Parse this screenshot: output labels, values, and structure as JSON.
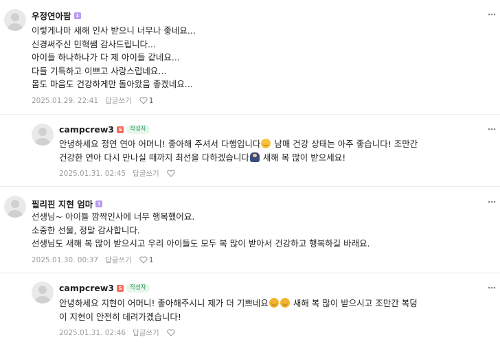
{
  "comments": [
    {
      "author": "우정연아팜",
      "level_badge": "1",
      "text": "이렇게나마 새해 인사 받으니 너무나 좋네요...\n신경써주신 민혁쌤 감사드립니다...\n아이들 하나하나가 다 제 아이들 같네요...\n다들 기특하고 이쁘고 사랑스럽네요...\n몸도 마음도 건강하게만 돌아왔음 좋겠네요...",
      "date": "2025.01.29. 22:41",
      "reply_label": "답글쓰기",
      "like_count": "1"
    },
    {
      "author": "campcrew3",
      "staff_badge": "S",
      "author_tag": "작성자",
      "text_parts": [
        "안녕하세요 정연 연아 어머니! 좋아해 주셔서 다행입니다",
        " 남매 건강 상태는 아주 좋습니다! 조만간\n건강한 연아 다시 만나실 때까지 최선을 다하겠습니다",
        " 새해 복 많이 받으세요!"
      ],
      "date": "2025.01.31. 02:45",
      "reply_label": "답글쓰기"
    },
    {
      "author": "필리핀 지현 엄마",
      "level_badge": "1",
      "text": "선생님~ 아이들 깜짝인사에 너무 행복했어요.\n소중한 선물, 정말 감사합니다.\n선생님도 새해 복 많이 받으시고 우리 아이들도 모두 복 많이 받아서 건강하고 행복하길 바래요.",
      "date": "2025.01.30. 00:37",
      "reply_label": "답글쓰기",
      "like_count": "1"
    },
    {
      "author": "campcrew3",
      "staff_badge": "S",
      "author_tag": "작성자",
      "text_parts": [
        "안녕하세요 지현이 어머니! 좋아해주시니 제가 더 기쁘네요",
        " 새해 복 많이 받으시고 조만간 복덩\n이 지현이 안전히 데려가겠습니다!"
      ],
      "date": "2025.01.31. 02:46",
      "reply_label": "답글쓰기"
    }
  ],
  "icons": {
    "more": "more-vertical-icon",
    "like": "heart-icon",
    "avatar": "default-avatar-icon",
    "smile_emoji": "smiling-face-emoji",
    "sweat_emoji": "grinning-sweat-emoji",
    "bow_emoji": "person-bowing-emoji"
  }
}
